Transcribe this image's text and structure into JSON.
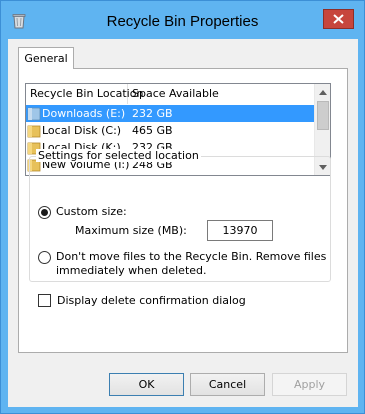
{
  "window": {
    "title": "Recycle Bin Properties"
  },
  "tabs": [
    {
      "label": "General"
    }
  ],
  "list": {
    "columns": [
      "Recycle Bin Location",
      "Space Available"
    ],
    "rows": [
      {
        "name": "Downloads (E:)",
        "space": "232 GB",
        "selected": true
      },
      {
        "name": "Local Disk (C:)",
        "space": "465 GB",
        "selected": false
      },
      {
        "name": "Local Disk (K:)",
        "space": "232 GB",
        "selected": false
      },
      {
        "name": "New Volume (I:)",
        "space": "248 GB",
        "selected": false
      }
    ]
  },
  "settings": {
    "group_title": "Settings for selected location",
    "custom_size_label": "Custom size:",
    "custom_size_selected": true,
    "max_size_label": "Maximum size (MB):",
    "max_size_value": "13970",
    "dont_move_line1": "Don't move files to the Recycle Bin. Remove files",
    "dont_move_line2": "immediately when deleted.",
    "dont_move_selected": false
  },
  "confirm_dialog": {
    "label": "Display delete confirmation dialog",
    "checked": false
  },
  "buttons": {
    "ok": "OK",
    "cancel": "Cancel",
    "apply": "Apply"
  },
  "colors": {
    "titlebar": "#5fb4f1",
    "close": "#c7463d",
    "selection": "#3399ff"
  }
}
